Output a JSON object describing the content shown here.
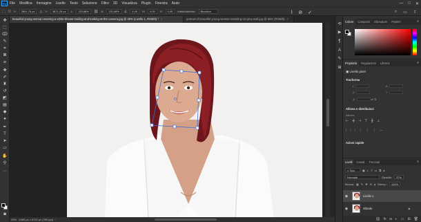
{
  "app": {
    "logo": "Ps"
  },
  "menu": [
    "File",
    "Modifica",
    "Immagine",
    "Livello",
    "Testo",
    "Selezione",
    "Filtro",
    "3D",
    "Visualizza",
    "Plugin",
    "Finestra",
    "Aiuto"
  ],
  "window_controls": {
    "minimize": "—",
    "maximize": "□",
    "close": "✕"
  },
  "options": {
    "x_label": "X:",
    "x_value": "2801,76 px",
    "y_label": "Y:",
    "y_value": "3871,28 px",
    "w_label": "L:",
    "w_value": "133,68%",
    "h_label": "A:",
    "h_value": "133,68%",
    "angle_value": "4,00",
    "h_skew_label": "H:",
    "h_skew_value": "0,00",
    "v_skew_label": "V:",
    "v_skew_value": "0,00",
    "interp_label": "Interpolazione:",
    "interp_value": "Bicubica",
    "cancel_icon": "⊘",
    "commit_icon": "✓"
  },
  "tabs": [
    {
      "label": "beautiful-young-woman-wearing-a-white-blouse-smiling-and-looking-at-the-camera.jpg @ 25% (Livello 1, RGB/8) *",
      "close": "×"
    },
    {
      "label": "portrait-of-beautiful-young-woman-standing-on-grey-wall.jpg @ 56% (RGB/8)",
      "close": "×"
    }
  ],
  "status": {
    "zoom": "25%",
    "doc_info": "4480 px x 6720 px (300 ppi)"
  },
  "color_panel": {
    "tabs": [
      "Colore",
      "Campioni",
      "Sfumature",
      "Pattern"
    ],
    "menu": "≡"
  },
  "properties": {
    "tabs": [
      "Proprietà",
      "Regolazioni",
      "Librerie"
    ],
    "layer_type": "Livello pixel",
    "transform_title": "Trasforma",
    "w_label": "L",
    "h_label": "A",
    "x_label": "X",
    "y_label": "Y",
    "align_title": "Allinea e distribuisci",
    "align_label": "Allinea:",
    "quick_actions_title": "Azioni rapide"
  },
  "layers": {
    "tabs": [
      "Livelli",
      "Canali",
      "Tracciati"
    ],
    "filter_label": "Tipo",
    "blend_mode": "Normale",
    "opacity_label": "Opacità:",
    "opacity_value": "37%",
    "lock_label": "Blocca:",
    "fill_label": "Riemp.:",
    "fill_value": "100%",
    "items": [
      {
        "name": "Livello 1",
        "selected": true
      },
      {
        "name": "Sfondo",
        "locked": true
      }
    ]
  },
  "colors": {
    "accent": "#31a8ff",
    "hair": "#8c1f25",
    "hue_top": "#ff0000"
  }
}
